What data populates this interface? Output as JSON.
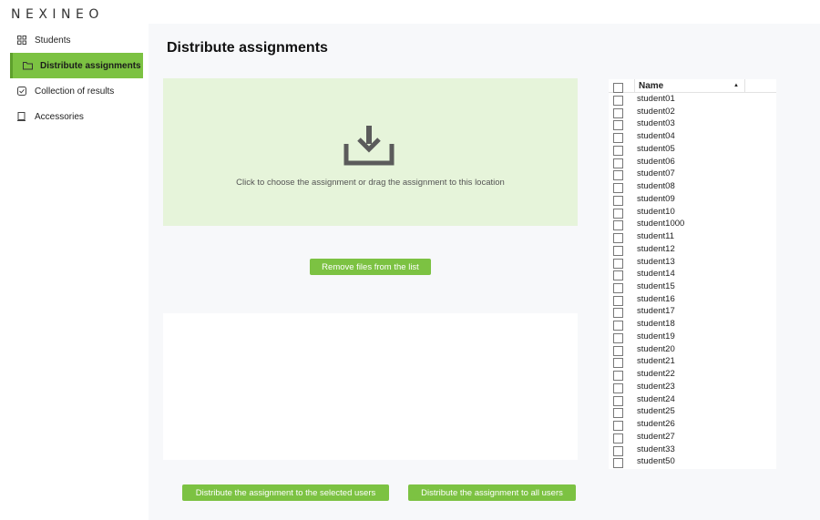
{
  "app": {
    "logo": "NEXINEO"
  },
  "sidebar": {
    "items": [
      {
        "label": "Students",
        "icon": "grid-icon",
        "active": false
      },
      {
        "label": "Distribute assignments",
        "icon": "folder-icon",
        "active": true
      },
      {
        "label": "Collection of results",
        "icon": "check-square-icon",
        "active": false
      },
      {
        "label": "Accessories",
        "icon": "tablet-icon",
        "active": false
      }
    ]
  },
  "main": {
    "title": "Distribute assignments",
    "dropzone": {
      "icon": "download-icon",
      "text": "Click to choose the assignment or drag the assignment to this location"
    },
    "remove_button": "Remove files from the list",
    "distribute_selected_button": "Distribute the assignment to the selected users",
    "distribute_all_button": "Distribute the assignment to all users"
  },
  "students_table": {
    "header": "Name",
    "sort": "ascending",
    "rows": [
      "student01",
      "student02",
      "student03",
      "student04",
      "student05",
      "student06",
      "student07",
      "student08",
      "student09",
      "student10",
      "student1000",
      "student11",
      "student12",
      "student13",
      "student14",
      "student15",
      "student16",
      "student17",
      "student18",
      "student19",
      "student20",
      "student21",
      "student22",
      "student23",
      "student24",
      "student25",
      "student26",
      "student27",
      "student33",
      "student50"
    ]
  },
  "colors": {
    "accent": "#7cc242",
    "dropzone_bg": "#e6f4da",
    "panel_bg": "#f7f8fa"
  }
}
